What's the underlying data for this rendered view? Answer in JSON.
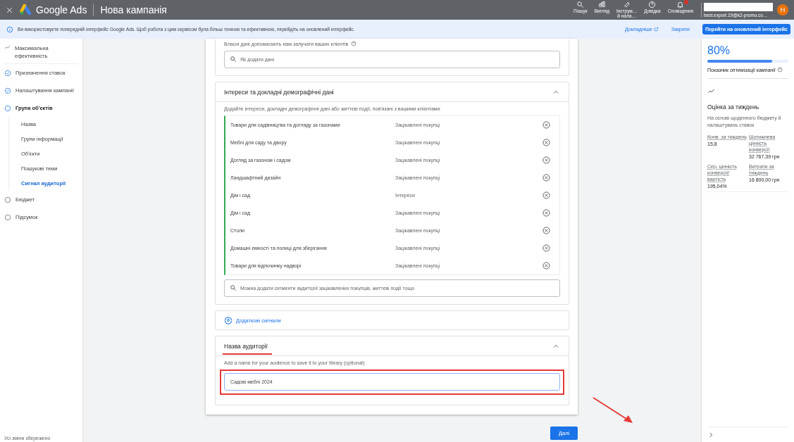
{
  "header": {
    "product": "Google Ads",
    "title": "Нова кампанія",
    "actions": [
      {
        "kind": "search",
        "label": "Пошук"
      },
      {
        "kind": "view",
        "label": "Вигляд"
      },
      {
        "kind": "tools",
        "label": "Інструм…\nй нала…"
      },
      {
        "kind": "help",
        "label": "Довідка"
      },
      {
        "kind": "bell",
        "label": "Сповіщення"
      }
    ],
    "account": "best.export.19@k2-promo.co…",
    "avatar": "Н"
  },
  "banner": {
    "text": "Ви використовуєте попередній інтерфейс Google Ads. Щоб робота з цим сервісом була більш точною та ефективною, перейдіть на оновлений інтерфейс.",
    "learn_more": "Докладніше",
    "close": "Закрити",
    "upgrade": "Перейти на оновлений інтерфейс"
  },
  "sidebar": {
    "campaign_type": "Максимальна ефективність",
    "steps": [
      {
        "label": "Призначення ставок",
        "completed": true,
        "selected": false
      },
      {
        "label": "Налаштування кампанії",
        "completed": true,
        "selected": false
      },
      {
        "label": "Група об'єктів",
        "completed": false,
        "selected": true,
        "children": [
          {
            "label": "Назва",
            "selected": false
          },
          {
            "label": "Групи інформації",
            "selected": false
          },
          {
            "label": "Об'єкти",
            "selected": false
          },
          {
            "label": "Пошукові теми",
            "selected": false
          },
          {
            "label": "Сигнал аудиторії",
            "selected": true
          }
        ]
      },
      {
        "label": "Бюджет",
        "completed": false,
        "selected": false
      },
      {
        "label": "Підсумок",
        "completed": false,
        "selected": false
      }
    ],
    "footer": "Усі зміни збережено"
  },
  "own_data": {
    "hint": "Власні дані допомагають нам залучати ваших клієнтів",
    "search_placeholder": "Як додати дані"
  },
  "interests": {
    "title": "Інтереси та докладні демографічні дані",
    "expanded": true,
    "description": "Додайте інтереси, докладні демографічні дані або життєві події, пов'язані з вашими клієнтами",
    "items": [
      {
        "name": "Товари для садівництва та догляду за газонами",
        "type": "Зацікавлені покупці"
      },
      {
        "name": "Меблі для саду та двору",
        "type": "Зацікавлені покупці"
      },
      {
        "name": "Догляд за газоном і садом",
        "type": "Зацікавлені покупці"
      },
      {
        "name": "Ландшафтний дизайн",
        "type": "Зацікавлені покупці"
      },
      {
        "name": "Дім і сад",
        "type": "Інтереси"
      },
      {
        "name": "Дім і сад",
        "type": "Зацікавлені покупці"
      },
      {
        "name": "Столи",
        "type": "Зацікавлені покупці"
      },
      {
        "name": "Домашні ємності та полиці для зберігання",
        "type": "Зацікавлені покупці"
      },
      {
        "name": "Товари для відпочинку надворі",
        "type": "Зацікавлені покупці"
      }
    ],
    "search_placeholder": "Можна додати сегменти аудиторії зацікавлених покупців, життєві події тощо"
  },
  "additional_signals": "Додаткові сигнали",
  "audience_name": {
    "title": "Назва аудиторії",
    "expanded": true,
    "description": "Add a name for your audience to save it to your library (optional)",
    "value": "Садові меблі 2024"
  },
  "next_button": "Далі",
  "optimization": {
    "score": "80%",
    "level": 0.8,
    "label": "Показник оптимізації кампанії"
  },
  "weekly": {
    "title": "Оцінка за тиждень",
    "description": "На основі щоденного бюджету й налаштувань ставок",
    "metrics": [
      {
        "label": "Конв. за тиждень",
        "value": "15,8"
      },
      {
        "label": "Шотижнева цінність конверсії",
        "value": "32 767,39 грн"
      },
      {
        "label": "Сер. цінність конверсії/вартість",
        "value": "195,04%"
      },
      {
        "label": "Витрати за тиждень",
        "value": "16 800,00 грн"
      }
    ]
  }
}
